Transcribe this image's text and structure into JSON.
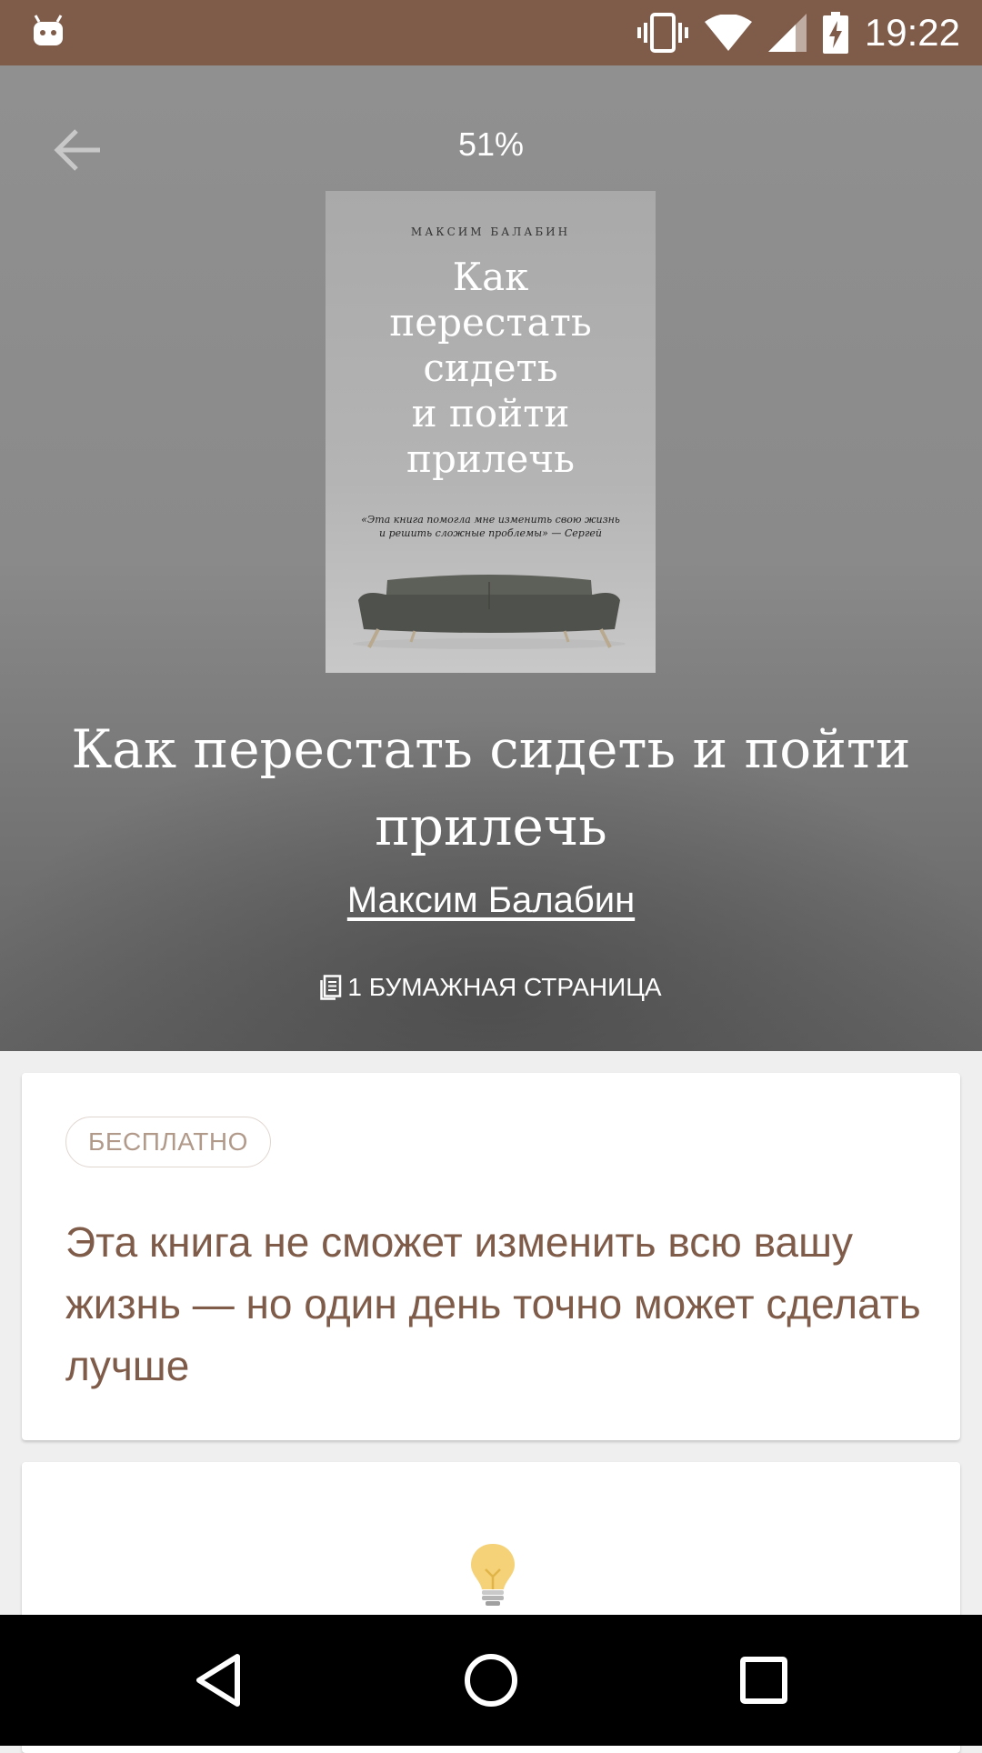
{
  "status_bar": {
    "time": "19:22",
    "icons": [
      "android-debug-icon",
      "vibrate-icon",
      "wifi-icon",
      "cell-signal-icon",
      "battery-charging-icon"
    ]
  },
  "header": {
    "progress": "51%",
    "back_icon": "arrow-left-icon"
  },
  "cover": {
    "author": "МАКСИМ БАЛАБИН",
    "title_lines": [
      "Как",
      "перестать",
      "сидеть",
      "и пойти",
      "прилечь"
    ],
    "quote_lines": [
      "«Эта книга помогла мне изменить свою жизнь",
      "и решить сложные проблемы» — Сергей"
    ]
  },
  "book": {
    "title": "Как перестать сидеть и пойти прилечь",
    "author": "Максим Балабин",
    "pages_label": "1 БУМАЖНАЯ СТРАНИЦА",
    "pages_icon": "document-pages-icon"
  },
  "card1": {
    "badge": "БЕСПЛАТНО",
    "description": "Эта книга не сможет изменить всю вашу жизнь — но один день точно может сделать лучше"
  },
  "card2": {
    "icon": "light-bulb-icon"
  },
  "nav_bar": {
    "icons": [
      "back-triangle-icon",
      "home-circle-icon",
      "recents-square-icon"
    ]
  },
  "colors": {
    "status_bar": "#7f5b49",
    "accent_text": "#7f5b49",
    "badge_text": "#b29a8b"
  }
}
